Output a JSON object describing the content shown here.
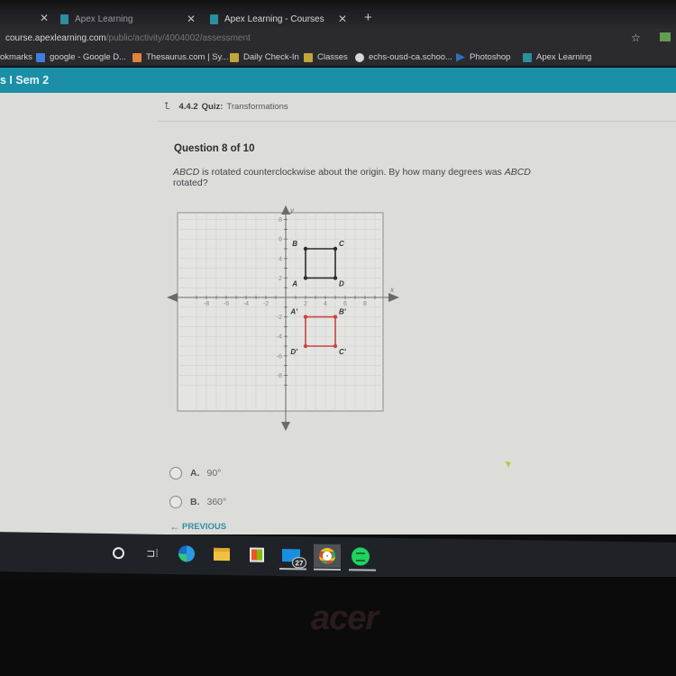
{
  "browser": {
    "tabs": [
      {
        "label": "Apex Learning",
        "active": false
      },
      {
        "label": "Apex Learning - Courses",
        "active": true
      }
    ],
    "url_host": "course.apexlearning.com",
    "url_path": "/public/activity/4004002/assessment",
    "bookmarks": [
      {
        "label": "okmarks",
        "icon": "folder-icon",
        "color": "#2b2a2e"
      },
      {
        "label": "google - Google D...",
        "icon": "docs-icon",
        "color": "#3f7fe0"
      },
      {
        "label": "Thesaurus.com | Sy...",
        "icon": "thesaurus-icon",
        "color": "#e0843c"
      },
      {
        "label": "Daily Check-In",
        "icon": "classroom-icon",
        "color": "#c2a53a"
      },
      {
        "label": "Classes",
        "icon": "classroom-icon",
        "color": "#c2a53a"
      },
      {
        "label": "echs-ousd-ca.schoo...",
        "icon": "globe-icon",
        "color": "#d8d8d8"
      },
      {
        "label": "Photoshop",
        "icon": "photoshop-icon",
        "color": "#2f6fb8"
      },
      {
        "label": "Apex Learning",
        "icon": "apex-icon",
        "color": "#2a8fa0"
      }
    ]
  },
  "app": {
    "course_title": "s I Sem 2",
    "brand_color": "#1a8fa6"
  },
  "quiz": {
    "breadcrumb_num": "4.4.2",
    "breadcrumb_type": "Quiz:",
    "breadcrumb_title": "Transformations",
    "question_heading": "Question 8 of 10",
    "question_italic_1": "ABCD",
    "question_text_1": " is rotated counterclockwise about the origin. By how many degrees was ",
    "question_italic_2": "ABCD",
    "question_text_2": " rotated?",
    "choices": [
      {
        "letter": "A.",
        "text": "90°"
      },
      {
        "letter": "B.",
        "text": "360°"
      }
    ],
    "previous_label": "PREVIOUS"
  },
  "chart_data": {
    "type": "scatter",
    "title": "",
    "xlabel": "x",
    "ylabel": "y",
    "xlim": [
      -9,
      9
    ],
    "ylim": [
      -9,
      9
    ],
    "grid": true,
    "xticks": [
      -8,
      -6,
      -4,
      -2,
      2,
      4,
      6,
      8
    ],
    "yticks": [
      -8,
      -6,
      -4,
      -2,
      2,
      4,
      6,
      8
    ],
    "series": [
      {
        "name": "ABCD",
        "color": "#2b2b2b",
        "closed": true,
        "points": [
          {
            "label": "A",
            "x": 2,
            "y": 2
          },
          {
            "label": "B",
            "x": 2,
            "y": 5
          },
          {
            "label": "C",
            "x": 5,
            "y": 5
          },
          {
            "label": "D",
            "x": 5,
            "y": 2
          }
        ]
      },
      {
        "name": "A'B'C'D'",
        "color": "#c8453e",
        "closed": true,
        "points": [
          {
            "label": "A'",
            "x": 2,
            "y": -2
          },
          {
            "label": "B'",
            "x": 5,
            "y": -2
          },
          {
            "label": "C'",
            "x": 5,
            "y": -5
          },
          {
            "label": "D'",
            "x": 2,
            "y": -5
          }
        ]
      }
    ]
  },
  "taskbar": {
    "items": [
      {
        "name": "cortana"
      },
      {
        "name": "task-view"
      },
      {
        "name": "edge"
      },
      {
        "name": "file-explorer"
      },
      {
        "name": "store"
      },
      {
        "name": "mail",
        "badge": "27"
      },
      {
        "name": "chrome"
      },
      {
        "name": "spotify"
      }
    ]
  },
  "laptop": {
    "brand": "acer"
  }
}
